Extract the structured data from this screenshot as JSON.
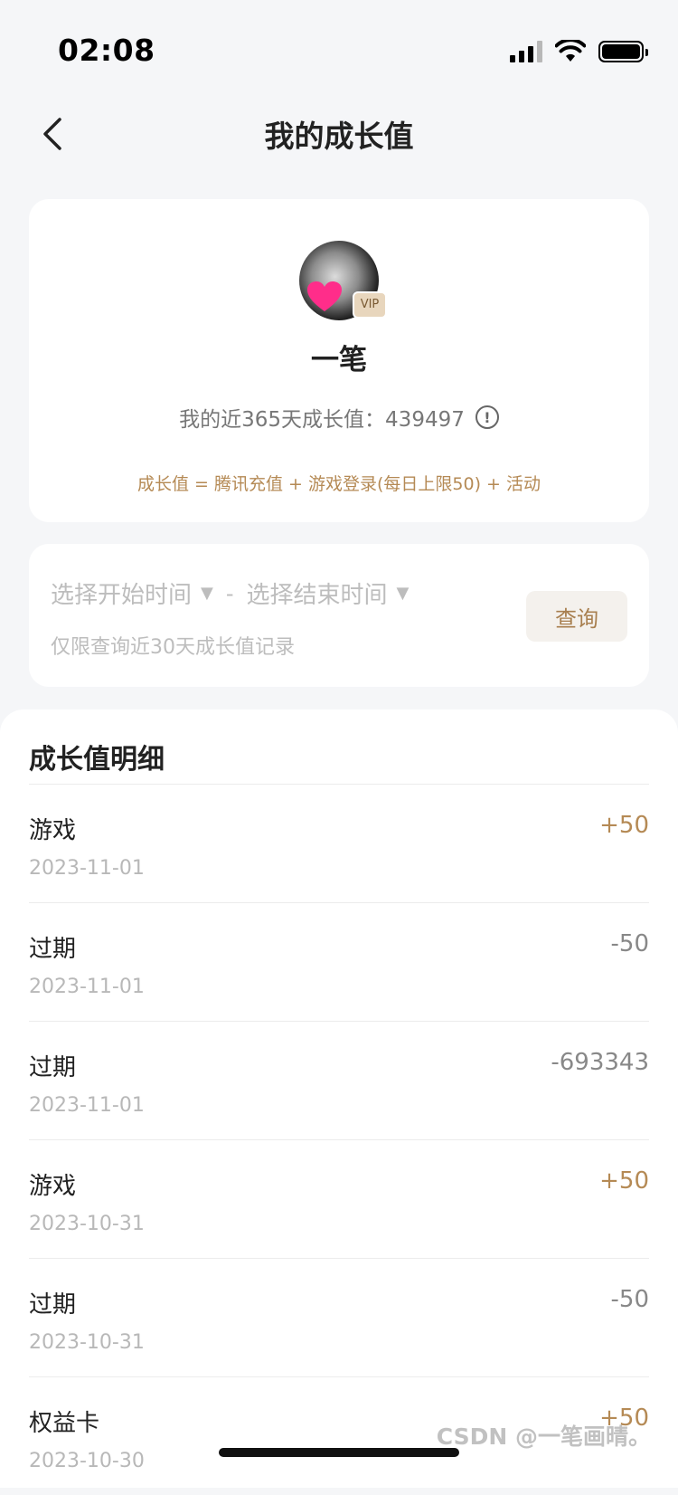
{
  "status_bar": {
    "time": "02:08"
  },
  "nav": {
    "title": "我的成长值"
  },
  "profile": {
    "avatar_badge": "VIP",
    "nickname": "一笔",
    "summary_label": "我的近365天成长值：",
    "summary_value": "439497",
    "formula": "成长值 = 腾讯充值 + 游戏登录(每日上限50) + 活动"
  },
  "filter": {
    "start_placeholder": "选择开始时间",
    "dash": "-",
    "end_placeholder": "选择结束时间",
    "note": "仅限查询近30天成长值记录",
    "query_label": "查询"
  },
  "details": {
    "title": "成长值明细",
    "records": [
      {
        "type": "游戏",
        "date": "2023-11-01",
        "amount": "+50"
      },
      {
        "type": "过期",
        "date": "2023-11-01",
        "amount": "-50"
      },
      {
        "type": "过期",
        "date": "2023-11-01",
        "amount": "-693343"
      },
      {
        "type": "游戏",
        "date": "2023-10-31",
        "amount": "+50"
      },
      {
        "type": "过期",
        "date": "2023-10-31",
        "amount": "-50"
      },
      {
        "type": "权益卡",
        "date": "2023-10-30",
        "amount": "+50"
      }
    ]
  },
  "watermark": "CSDN @一笔画晴。",
  "colors": {
    "accent": "#b58a55",
    "negative": "#888888",
    "background": "#f5f6f8"
  }
}
